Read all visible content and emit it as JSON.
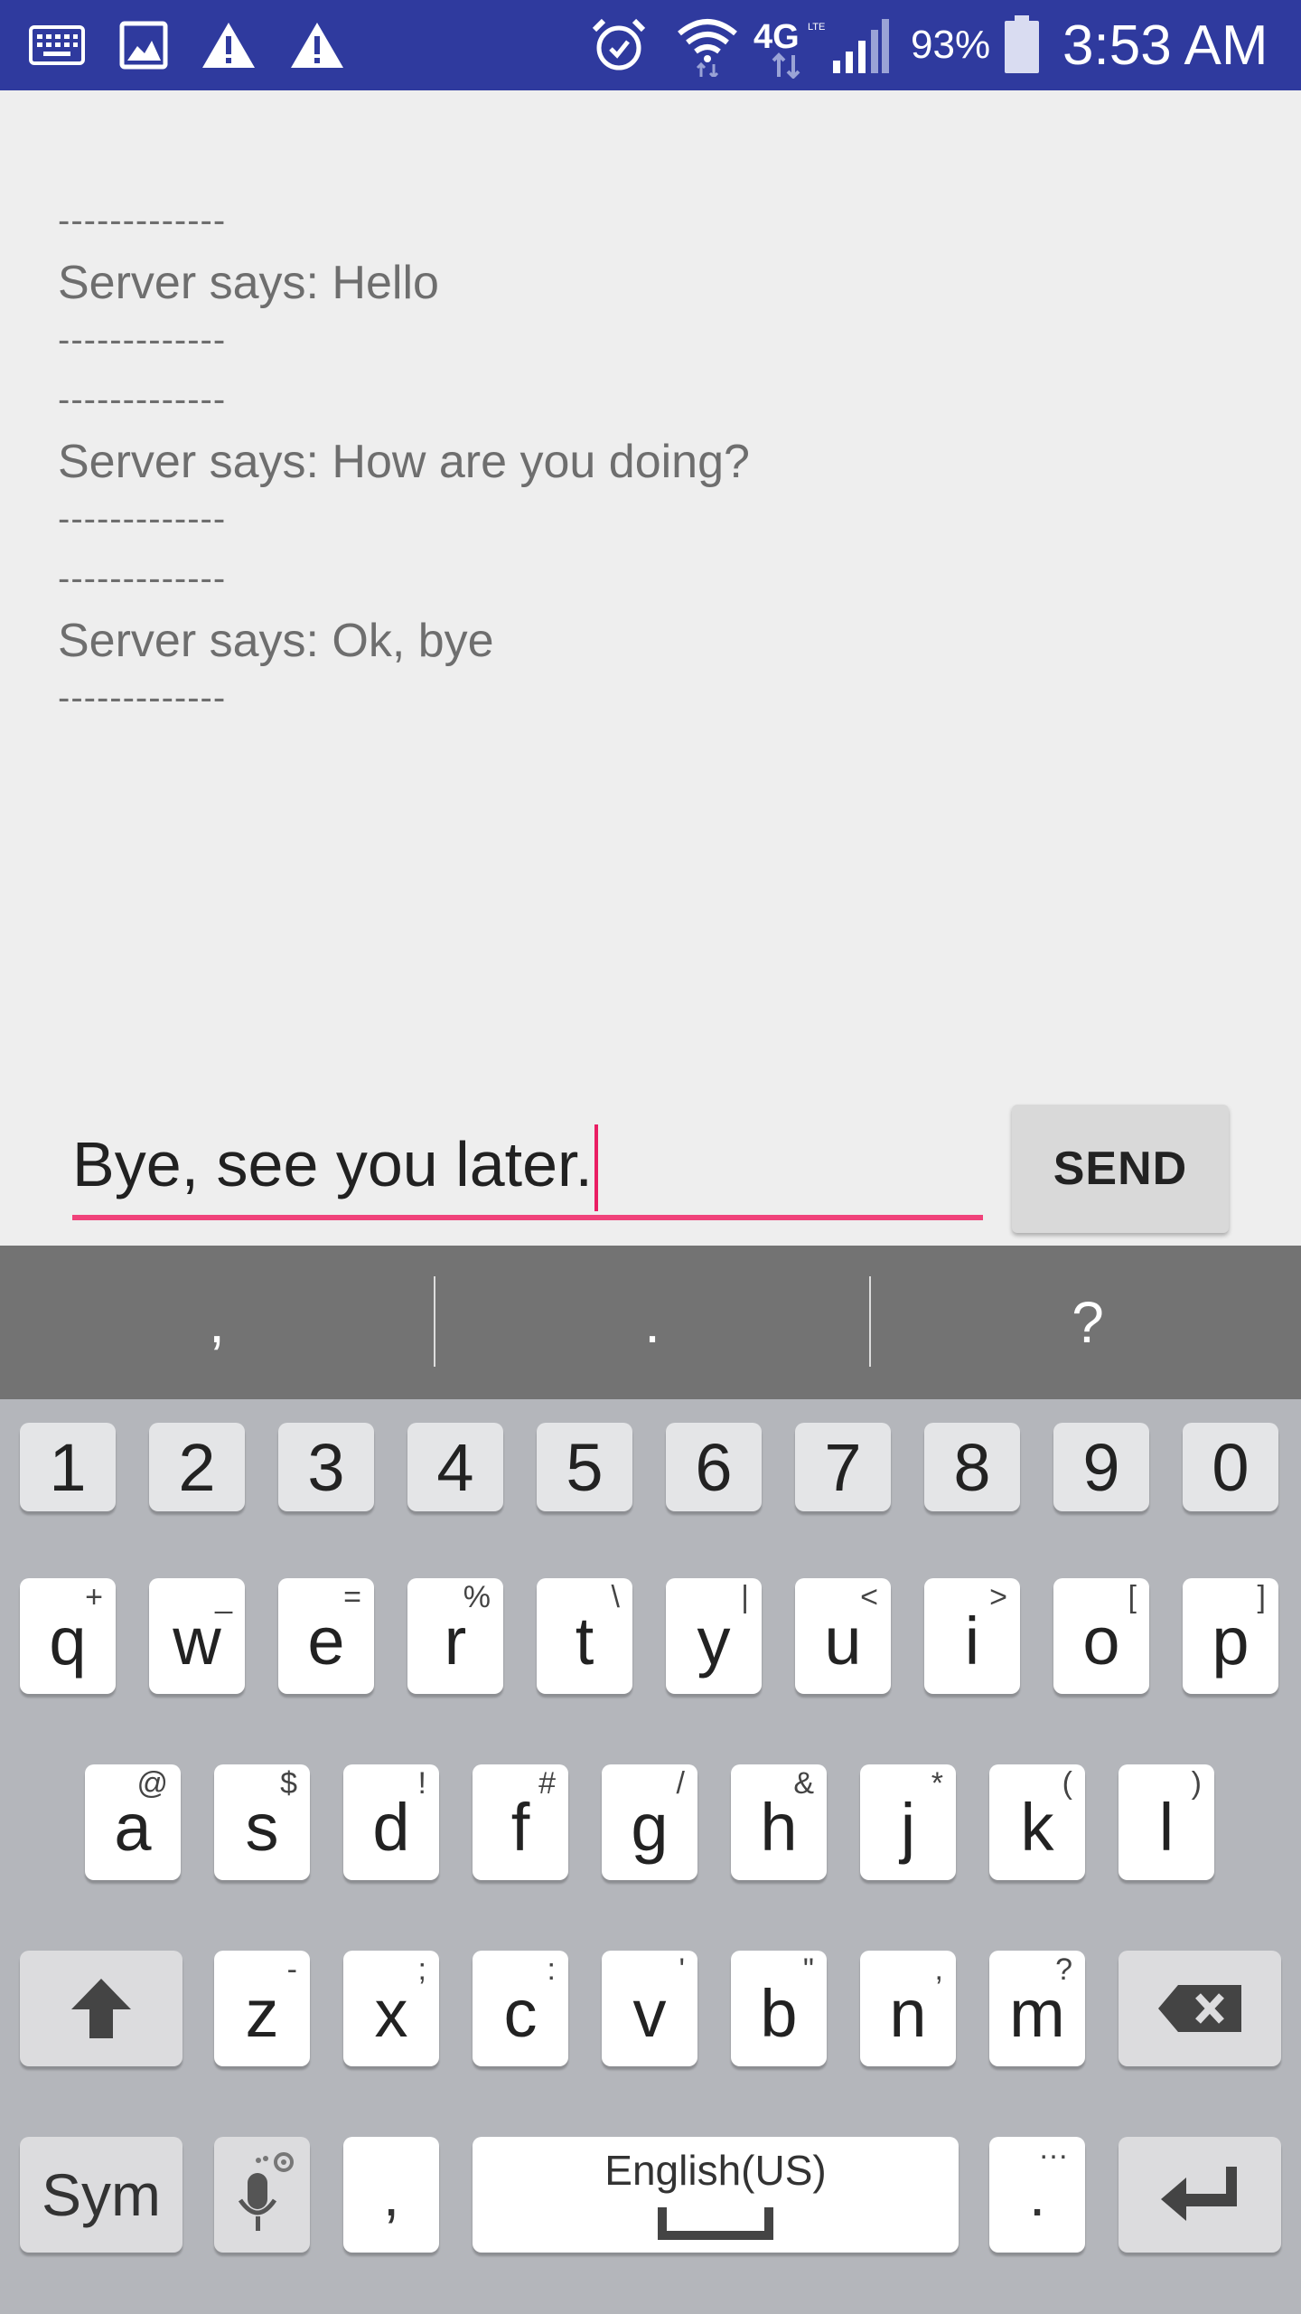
{
  "status_bar": {
    "battery_percent": "93%",
    "time": "3:53 AM",
    "icons": [
      "keyboard-icon",
      "image-icon",
      "warning-icon",
      "warning-icon",
      "alarm-icon",
      "wifi-icon",
      "4g-lte-icon",
      "signal-icon",
      "battery-icon"
    ],
    "network_label": "4G"
  },
  "chat": {
    "messages": [
      {
        "separator_top": "-------------",
        "text": "Server says: Hello",
        "separator_bottom": "-------------"
      },
      {
        "separator_top": "-------------",
        "text": "Server says: How are you doing?",
        "separator_bottom": "-------------"
      },
      {
        "separator_top": "-------------",
        "text": "Server says: Ok, bye",
        "separator_bottom": "-------------"
      }
    ]
  },
  "composer": {
    "input_value": "Bye, see you later.",
    "send_label": "SEND"
  },
  "keyboard": {
    "suggestions": [
      ",",
      ".",
      "?"
    ],
    "number_row": [
      "1",
      "2",
      "3",
      "4",
      "5",
      "6",
      "7",
      "8",
      "9",
      "0"
    ],
    "row1": [
      {
        "key": "q",
        "hint": "+"
      },
      {
        "key": "w",
        "hint": "_"
      },
      {
        "key": "e",
        "hint": "="
      },
      {
        "key": "r",
        "hint": "%"
      },
      {
        "key": "t",
        "hint": "\\"
      },
      {
        "key": "y",
        "hint": "|"
      },
      {
        "key": "u",
        "hint": "<"
      },
      {
        "key": "i",
        "hint": ">"
      },
      {
        "key": "o",
        "hint": "["
      },
      {
        "key": "p",
        "hint": "]"
      }
    ],
    "row2": [
      {
        "key": "a",
        "hint": "@"
      },
      {
        "key": "s",
        "hint": "$"
      },
      {
        "key": "d",
        "hint": "!"
      },
      {
        "key": "f",
        "hint": "#"
      },
      {
        "key": "g",
        "hint": "/"
      },
      {
        "key": "h",
        "hint": "&"
      },
      {
        "key": "j",
        "hint": "*"
      },
      {
        "key": "k",
        "hint": "("
      },
      {
        "key": "l",
        "hint": ")"
      }
    ],
    "row3": [
      {
        "key": "z",
        "hint": "-"
      },
      {
        "key": "x",
        "hint": ";"
      },
      {
        "key": "c",
        "hint": ":"
      },
      {
        "key": "v",
        "hint": "'"
      },
      {
        "key": "b",
        "hint": "\""
      },
      {
        "key": "n",
        "hint": ","
      },
      {
        "key": "m",
        "hint": "?"
      }
    ],
    "sym_label": "Sym",
    "comma_label": ",",
    "space_label": "English(US)",
    "period_label": ".",
    "period_hint": "…"
  }
}
